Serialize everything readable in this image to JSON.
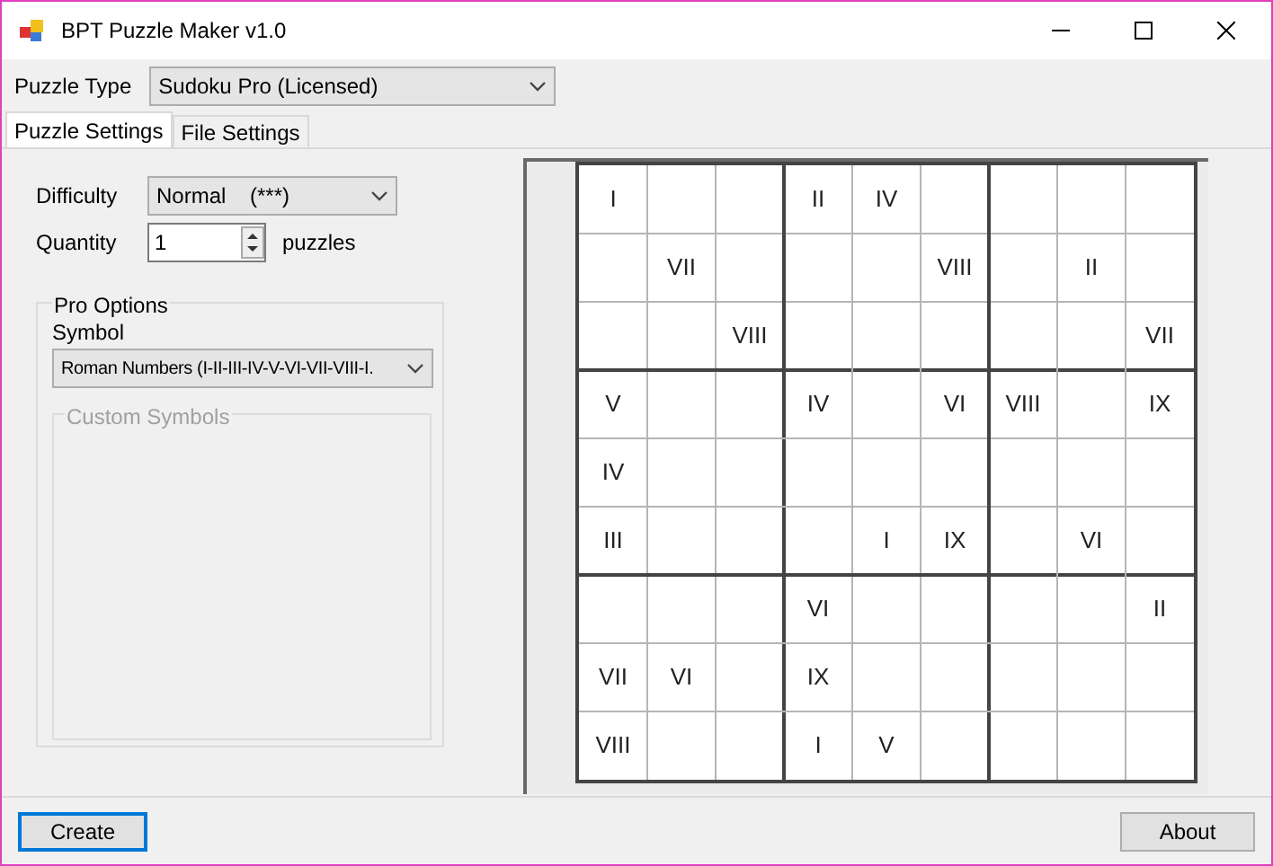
{
  "window": {
    "title": "BPT Puzzle Maker v1.0"
  },
  "puzzle_type": {
    "label": "Puzzle Type",
    "value": "Sudoku Pro (Licensed)"
  },
  "tabs": [
    {
      "label": "Puzzle Settings",
      "selected": true
    },
    {
      "label": "File Settings",
      "selected": false
    }
  ],
  "difficulty": {
    "label": "Difficulty",
    "value": "Normal    (***)"
  },
  "quantity": {
    "label": "Quantity",
    "value": "1",
    "unit": "puzzles"
  },
  "pro_options": {
    "title": "Pro Options",
    "symbol_label": "Symbol",
    "symbol_value": "Roman Numbers (I-II-III-IV-V-VI-VII-VIII-I.",
    "custom_symbols": {
      "title": "Custom Symbols",
      "disabled": true
    }
  },
  "grid_rows": [
    {
      "column_1": "I",
      "column_4": "II",
      "column_5": "IV"
    },
    {
      "column_2": "VII",
      "column_6": "VIII",
      "column_8": "II"
    },
    {
      "column_3": "VIII",
      "column_9": "VII"
    },
    {
      "column_1": "V",
      "column_4": "IV",
      "column_6": "VI",
      "column_7": "VIII",
      "column_9": "IX"
    },
    {
      "column_1": "IV"
    },
    {
      "column_1": "III",
      "column_5": "I",
      "column_6": "IX",
      "column_8": "VI"
    },
    {
      "column_4": "VI",
      "column_9": "II"
    },
    {
      "column_1": "VII",
      "column_2": "VI",
      "column_4": "IX"
    },
    {
      "column_1": "VIII",
      "column_4": "I",
      "column_5": "V"
    }
  ],
  "buttons": {
    "create": "Create",
    "about": "About"
  }
}
